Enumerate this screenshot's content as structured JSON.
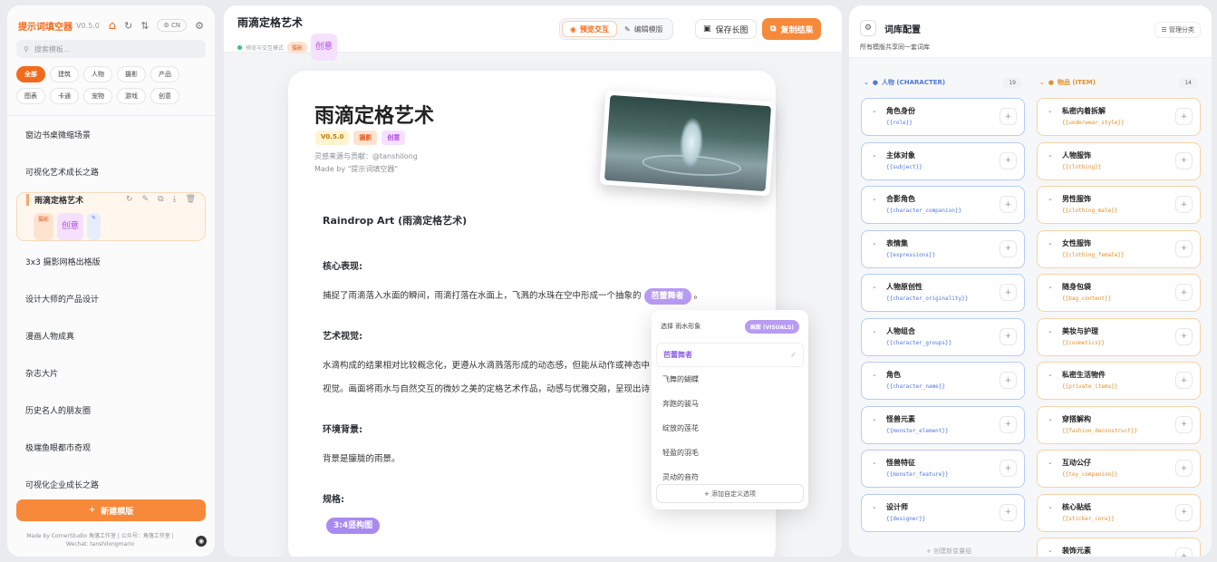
{
  "left": {
    "app_title": "提示词填空器",
    "version": "V0.5.0",
    "lang_label": "CN",
    "search_placeholder": "搜索模板...",
    "tags": [
      "全部",
      "建筑",
      "人物",
      "摄影",
      "产品",
      "图表",
      "卡通",
      "宠物",
      "游戏",
      "创意"
    ],
    "templates": [
      "窗边书桌微缩场景",
      "可视化艺术成长之路",
      "雨滴定格艺术",
      "3x3 摄影网格出格版",
      "设计大师的产品设计",
      "漫画人物成真",
      "杂志大片",
      "历史名人的朋友圈",
      "极端鱼眼都市奇观",
      "可视化企业成长之路"
    ],
    "selected_tags": [
      "摄影",
      "创意"
    ],
    "new_button": "新建模版",
    "footer": "Made by CornerStudio 角落工作室 | 公众号：角落工作室 | Wechat: tanshilongmario"
  },
  "mid": {
    "title": "雨滴定格艺术",
    "subtitle": "预览与交互模式",
    "tags": [
      "摄影",
      "创意"
    ],
    "preview_tab": "预览交互",
    "edit_tab": "编辑模版",
    "save_button": "保存长图",
    "copy_button": "复制结果",
    "card": {
      "title": "雨滴定格艺术",
      "version": "V0.5.0",
      "badges": [
        "摄影",
        "创意"
      ],
      "credit": "灵感来源与贡献：@tanshilong",
      "made_by": "Made by \"提示词填空器\"",
      "heading": "Raindrop Art (雨滴定格艺术)",
      "s1": "核心表现:",
      "p1": "捕捉了雨滴落入水面的瞬间，雨滴打落在水面上，飞溅的水珠在空中形成一个抽象的",
      "chip1": "芭蕾舞者",
      "p1_end": "。",
      "s2": "艺术视觉:",
      "p2a": "水滴构成的结果相对比较概念化，更遵从水滴溅落形成的动态感，但能从动作或神态中",
      "p2b": "视觉。画面将雨水与自然交互的微妙之美的定格艺术作品，动感与优雅交融，呈现出诗",
      "s3": "环境背景:",
      "p3": "背景是朦胧的雨景。",
      "s4": "规格:",
      "chip2": "3:4竖构图"
    },
    "dropdown": {
      "label": "选择 雨水形象",
      "badge": "画面 (VISUALS)",
      "options": [
        "芭蕾舞者",
        "飞舞的蝴蝶",
        "奔跑的骏马",
        "绽放的莲花",
        "轻盈的羽毛",
        "灵动的音符"
      ],
      "add": "添加自定义选项"
    }
  },
  "right": {
    "title": "词库配置",
    "subtitle": "所有模版共享同一套词库",
    "manage": "管理分类",
    "col1": {
      "name": "人物 (CHARACTER)",
      "count": "19",
      "items": [
        {
          "name": "角色身份",
          "key": "{{role}}"
        },
        {
          "name": "主体对象",
          "key": "{{subject}}"
        },
        {
          "name": "合影角色",
          "key": "{{character_companion}}"
        },
        {
          "name": "表情集",
          "key": "{{expressions}}"
        },
        {
          "name": "人物原创性",
          "key": "{{character_originality}}"
        },
        {
          "name": "人物组合",
          "key": "{{character_groups}}"
        },
        {
          "name": "角色",
          "key": "{{character_name}}"
        },
        {
          "name": "怪兽元素",
          "key": "{{monster_element}}"
        },
        {
          "name": "怪兽特征",
          "key": "{{monster_feature}}"
        },
        {
          "name": "设计师",
          "key": "{{designer}}"
        }
      ]
    },
    "col2": {
      "name": "物品 (ITEM)",
      "count": "14",
      "items": [
        {
          "name": "私密内着拆解",
          "key": "{{underwear_style}}"
        },
        {
          "name": "人物服饰",
          "key": "{{clothing}}"
        },
        {
          "name": "男性服饰",
          "key": "{{clothing_male}}"
        },
        {
          "name": "女性服饰",
          "key": "{{clothing_female}}"
        },
        {
          "name": "随身包袋",
          "key": "{{bag_content}}"
        },
        {
          "name": "美妆与护理",
          "key": "{{cosmetics}}"
        },
        {
          "name": "私密生活物件",
          "key": "{{private_items}}"
        },
        {
          "name": "穿搭解构",
          "key": "{{fashion_deconstruct}}"
        },
        {
          "name": "互动公仔",
          "key": "{{toy_companion}}"
        },
        {
          "name": "核心贴纸",
          "key": "{{sticker_core}}"
        },
        {
          "name": "装饰元素",
          "key": ""
        }
      ]
    },
    "new_group": "创建新变量组"
  }
}
